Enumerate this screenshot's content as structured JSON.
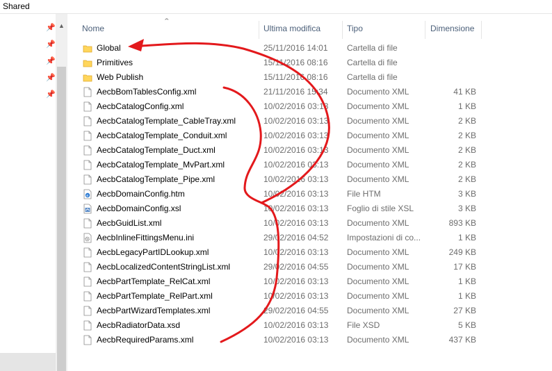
{
  "window": {
    "title": "Shared"
  },
  "columns": {
    "name": "Nome",
    "modified": "Ultima modifica",
    "type": "Tipo",
    "size": "Dimensione"
  },
  "files": [
    {
      "name": "Global",
      "modified": "25/11/2016 14:01",
      "type": "Cartella di file",
      "size": "",
      "icon": "folder-icon"
    },
    {
      "name": "Primitives",
      "modified": "15/11/2016 08:16",
      "type": "Cartella di file",
      "size": "",
      "icon": "folder-icon"
    },
    {
      "name": "Web Publish",
      "modified": "15/11/2016 08:16",
      "type": "Cartella di file",
      "size": "",
      "icon": "folder-icon"
    },
    {
      "name": "AecbBomTablesConfig.xml",
      "modified": "21/11/2016 15:34",
      "type": "Documento XML",
      "size": "41 KB",
      "icon": "xml-file-icon"
    },
    {
      "name": "AecbCatalogConfig.xml",
      "modified": "10/02/2016 03:13",
      "type": "Documento XML",
      "size": "1 KB",
      "icon": "xml-file-icon"
    },
    {
      "name": "AecbCatalogTemplate_CableTray.xml",
      "modified": "10/02/2016 03:13",
      "type": "Documento XML",
      "size": "2 KB",
      "icon": "xml-file-icon"
    },
    {
      "name": "AecbCatalogTemplate_Conduit.xml",
      "modified": "10/02/2016 03:13",
      "type": "Documento XML",
      "size": "2 KB",
      "icon": "xml-file-icon"
    },
    {
      "name": "AecbCatalogTemplate_Duct.xml",
      "modified": "10/02/2016 03:13",
      "type": "Documento XML",
      "size": "2 KB",
      "icon": "xml-file-icon"
    },
    {
      "name": "AecbCatalogTemplate_MvPart.xml",
      "modified": "10/02/2016 03:13",
      "type": "Documento XML",
      "size": "2 KB",
      "icon": "xml-file-icon"
    },
    {
      "name": "AecbCatalogTemplate_Pipe.xml",
      "modified": "10/02/2016 03:13",
      "type": "Documento XML",
      "size": "2 KB",
      "icon": "xml-file-icon"
    },
    {
      "name": "AecbDomainConfig.htm",
      "modified": "10/02/2016 03:13",
      "type": "File HTM",
      "size": "3 KB",
      "icon": "htm-file-icon"
    },
    {
      "name": "AecbDomainConfig.xsl",
      "modified": "10/02/2016 03:13",
      "type": "Foglio di stile XSL",
      "size": "3 KB",
      "icon": "xsl-file-icon"
    },
    {
      "name": "AecbGuidList.xml",
      "modified": "10/02/2016 03:13",
      "type": "Documento XML",
      "size": "893 KB",
      "icon": "xml-file-icon"
    },
    {
      "name": "AecbInlineFittingsMenu.ini",
      "modified": "29/02/2016 04:52",
      "type": "Impostazioni di co...",
      "size": "1 KB",
      "icon": "ini-file-icon"
    },
    {
      "name": "AecbLegacyPartIDLookup.xml",
      "modified": "10/02/2016 03:13",
      "type": "Documento XML",
      "size": "249 KB",
      "icon": "xml-file-icon"
    },
    {
      "name": "AecbLocalizedContentStringList.xml",
      "modified": "29/02/2016 04:55",
      "type": "Documento XML",
      "size": "17 KB",
      "icon": "xml-file-icon"
    },
    {
      "name": "AecbPartTemplate_RelCat.xml",
      "modified": "10/02/2016 03:13",
      "type": "Documento XML",
      "size": "1 KB",
      "icon": "xml-file-icon"
    },
    {
      "name": "AecbPartTemplate_RelPart.xml",
      "modified": "10/02/2016 03:13",
      "type": "Documento XML",
      "size": "1 KB",
      "icon": "xml-file-icon"
    },
    {
      "name": "AecbPartWizardTemplates.xml",
      "modified": "29/02/2016 04:55",
      "type": "Documento XML",
      "size": "27 KB",
      "icon": "xml-file-icon"
    },
    {
      "name": "AecbRadiatorData.xsd",
      "modified": "10/02/2016 03:13",
      "type": "File XSD",
      "size": "5 KB",
      "icon": "xsd-file-icon"
    },
    {
      "name": "AecbRequiredParams.xml",
      "modified": "10/02/2016 03:13",
      "type": "Documento XML",
      "size": "437 KB",
      "icon": "xml-file-icon"
    }
  ],
  "colors": {
    "header_text": "#4c607a",
    "meta_text": "#6d6d6d",
    "folder": "#ffd65c",
    "annotation": "#e3191c"
  }
}
